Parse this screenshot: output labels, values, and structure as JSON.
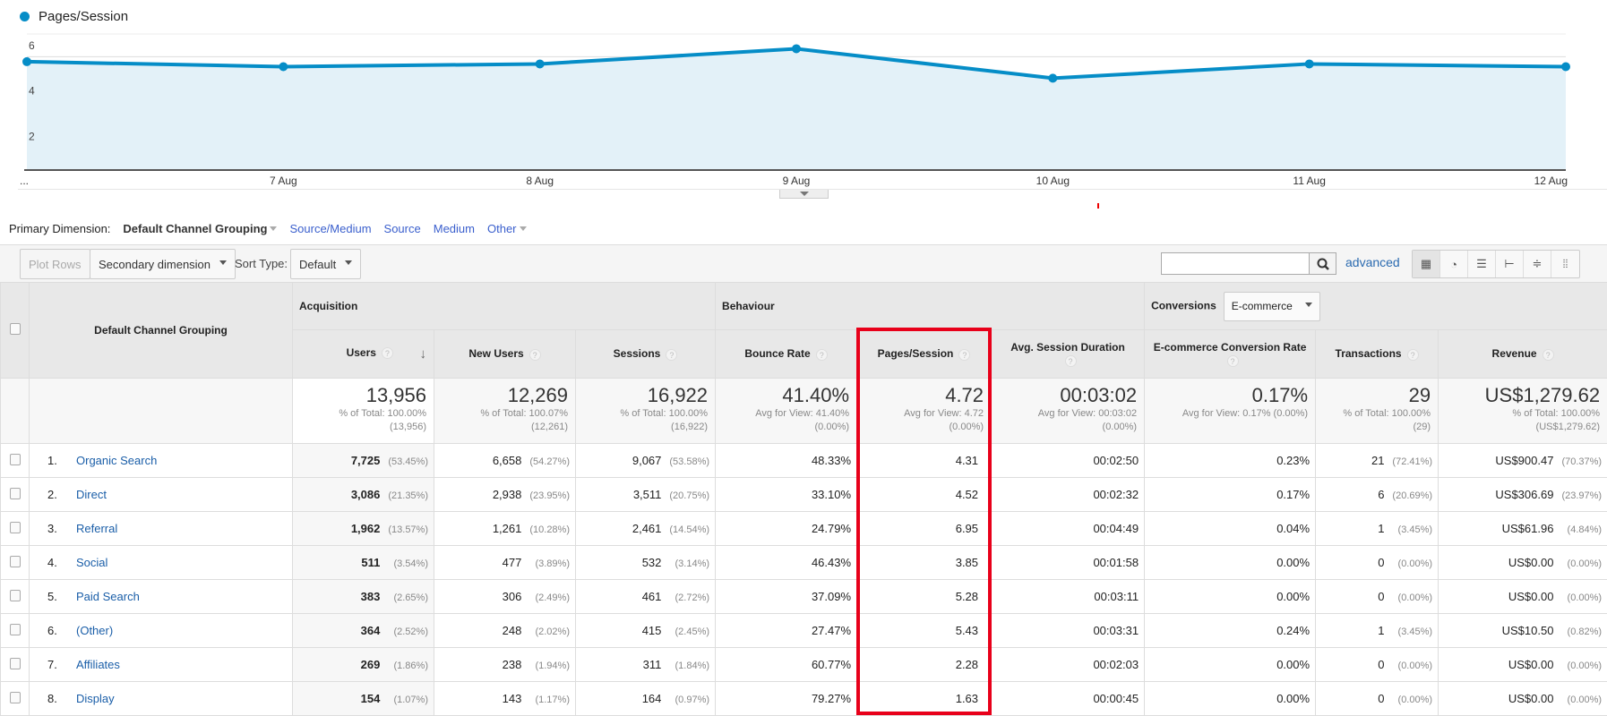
{
  "chart": {
    "legend": "Pages/Session",
    "color": "#058dc7",
    "fill": "#e3f1f8",
    "chart_data": {
      "type": "area",
      "series": [
        {
          "name": "Pages/Session",
          "values": [
            4.78,
            4.56,
            4.68,
            5.35,
            4.05,
            4.68,
            4.56
          ]
        }
      ],
      "x": [
        "...",
        "7 Aug",
        "8 Aug",
        "9 Aug",
        "10 Aug",
        "11 Aug",
        "12 Aug"
      ],
      "yticks": [
        "2",
        "4",
        "6"
      ],
      "ylim": [
        0,
        6
      ],
      "grid": true
    }
  },
  "primary_dimension": {
    "label": "Primary Dimension:",
    "selected": "Default Channel Grouping",
    "options": [
      "Source/Medium",
      "Source",
      "Medium",
      "Other"
    ]
  },
  "toolbar": {
    "plot_rows": "Plot Rows",
    "secondary": "Secondary dimension",
    "sort_label": "Sort Type:",
    "sort_value": "Default",
    "search_value": "",
    "advanced": "advanced",
    "views": [
      "table-view-icon",
      "pie-view-icon",
      "performance-view-icon",
      "comparison-view-icon",
      "term-cloud-view-icon",
      "pivot-view-icon"
    ]
  },
  "table": {
    "dimension_header": "Default Channel Grouping",
    "groups": {
      "acquisition": "Acquisition",
      "behaviour": "Behaviour",
      "conversions": "Conversions",
      "conversions_select": "E-commerce"
    },
    "columns": [
      "Users",
      "New Users",
      "Sessions",
      "Bounce Rate",
      "Pages/Session",
      "Avg. Session Duration",
      "E-commerce Conversion Rate",
      "Transactions",
      "Revenue"
    ],
    "totals": [
      {
        "v": "13,956",
        "s1": "% of Total: 100.00%",
        "s2": "(13,956)"
      },
      {
        "v": "12,269",
        "s1": "% of Total: 100.07%",
        "s2": "(12,261)"
      },
      {
        "v": "16,922",
        "s1": "% of Total: 100.00%",
        "s2": "(16,922)"
      },
      {
        "v": "41.40%",
        "s1": "Avg for View: 41.40%",
        "s2": "(0.00%)"
      },
      {
        "v": "4.72",
        "s1": "Avg for View: 4.72",
        "s2": "(0.00%)"
      },
      {
        "v": "00:03:02",
        "s1": "Avg for View: 00:03:02",
        "s2": "(0.00%)"
      },
      {
        "v": "0.17%",
        "s1": "Avg for View: 0.17% (0.00%)",
        "s2": ""
      },
      {
        "v": "29",
        "s1": "% of Total: 100.00%",
        "s2": "(29)"
      },
      {
        "v": "US$1,279.62",
        "s1": "% of Total: 100.00%",
        "s2": "(US$1,279.62)"
      }
    ],
    "rows": [
      {
        "i": "1.",
        "n": "Organic Search",
        "users": "7,725",
        "up": "(53.45%)",
        "nu": "6,658",
        "nup": "(54.27%)",
        "s": "9,067",
        "sp": "(53.58%)",
        "br": "48.33%",
        "ps": "4.31",
        "d": "00:02:50",
        "cr": "0.23%",
        "t": "21",
        "tp": "(72.41%)",
        "r": "US$900.47",
        "rp": "(70.37%)"
      },
      {
        "i": "2.",
        "n": "Direct",
        "users": "3,086",
        "up": "(21.35%)",
        "nu": "2,938",
        "nup": "(23.95%)",
        "s": "3,511",
        "sp": "(20.75%)",
        "br": "33.10%",
        "ps": "4.52",
        "d": "00:02:32",
        "cr": "0.17%",
        "t": "6",
        "tp": "(20.69%)",
        "r": "US$306.69",
        "rp": "(23.97%)"
      },
      {
        "i": "3.",
        "n": "Referral",
        "users": "1,962",
        "up": "(13.57%)",
        "nu": "1,261",
        "nup": "(10.28%)",
        "s": "2,461",
        "sp": "(14.54%)",
        "br": "24.79%",
        "ps": "6.95",
        "d": "00:04:49",
        "cr": "0.04%",
        "t": "1",
        "tp": "(3.45%)",
        "r": "US$61.96",
        "rp": "(4.84%)"
      },
      {
        "i": "4.",
        "n": "Social",
        "users": "511",
        "up": "(3.54%)",
        "nu": "477",
        "nup": "(3.89%)",
        "s": "532",
        "sp": "(3.14%)",
        "br": "46.43%",
        "ps": "3.85",
        "d": "00:01:58",
        "cr": "0.00%",
        "t": "0",
        "tp": "(0.00%)",
        "r": "US$0.00",
        "rp": "(0.00%)"
      },
      {
        "i": "5.",
        "n": "Paid Search",
        "users": "383",
        "up": "(2.65%)",
        "nu": "306",
        "nup": "(2.49%)",
        "s": "461",
        "sp": "(2.72%)",
        "br": "37.09%",
        "ps": "5.28",
        "d": "00:03:11",
        "cr": "0.00%",
        "t": "0",
        "tp": "(0.00%)",
        "r": "US$0.00",
        "rp": "(0.00%)"
      },
      {
        "i": "6.",
        "n": "(Other)",
        "users": "364",
        "up": "(2.52%)",
        "nu": "248",
        "nup": "(2.02%)",
        "s": "415",
        "sp": "(2.45%)",
        "br": "27.47%",
        "ps": "5.43",
        "d": "00:03:31",
        "cr": "0.24%",
        "t": "1",
        "tp": "(3.45%)",
        "r": "US$10.50",
        "rp": "(0.82%)"
      },
      {
        "i": "7.",
        "n": "Affiliates",
        "users": "269",
        "up": "(1.86%)",
        "nu": "238",
        "nup": "(1.94%)",
        "s": "311",
        "sp": "(1.84%)",
        "br": "60.77%",
        "ps": "2.28",
        "d": "00:02:03",
        "cr": "0.00%",
        "t": "0",
        "tp": "(0.00%)",
        "r": "US$0.00",
        "rp": "(0.00%)"
      },
      {
        "i": "8.",
        "n": "Display",
        "users": "154",
        "up": "(1.07%)",
        "nu": "143",
        "nup": "(1.17%)",
        "s": "164",
        "sp": "(0.97%)",
        "br": "79.27%",
        "ps": "1.63",
        "d": "00:00:45",
        "cr": "0.00%",
        "t": "0",
        "tp": "(0.00%)",
        "r": "US$0.00",
        "rp": "(0.00%)"
      }
    ]
  },
  "highlight_color": "#e8001a"
}
